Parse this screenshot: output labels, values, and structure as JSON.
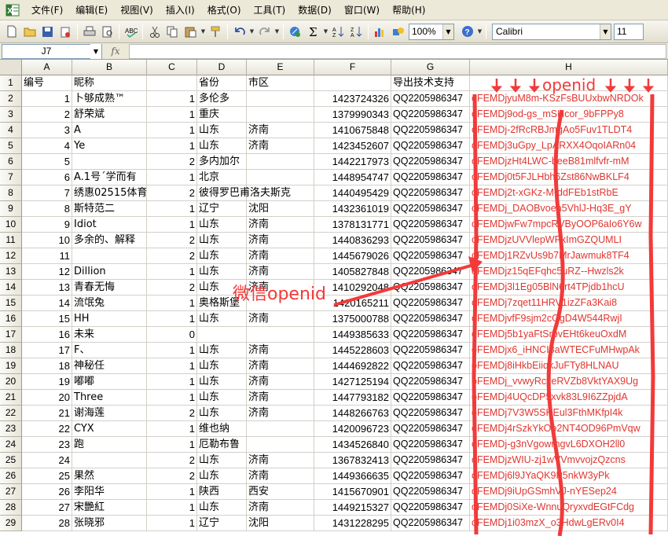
{
  "menu": {
    "items": [
      "文件(F)",
      "编辑(E)",
      "视图(V)",
      "插入(I)",
      "格式(O)",
      "工具(T)",
      "数据(D)",
      "窗口(W)",
      "帮助(H)"
    ]
  },
  "toolbar": {
    "zoom": "100%",
    "font_name": "Calibri",
    "font_size": "11",
    "icons": [
      "new-icon",
      "open-icon",
      "save-icon",
      "permission-icon",
      "print-icon",
      "print-preview-icon",
      "spelling-icon",
      "cut-icon",
      "copy-icon",
      "paste-icon",
      "format-painter-icon",
      "undo-icon",
      "redo-icon",
      "hyperlink-icon",
      "autosum-icon",
      "sort-asc-icon",
      "sort-desc-icon",
      "chart-wizard-icon",
      "drawing-icon",
      "help-icon"
    ]
  },
  "formula_bar": {
    "name_box": "J7",
    "fx_label": "fx",
    "value": ""
  },
  "sheet": {
    "columns": [
      "A",
      "B",
      "C",
      "D",
      "E",
      "F",
      "G",
      "H"
    ],
    "headers": {
      "a": "编号",
      "b": "昵称",
      "c": "",
      "d": "省份",
      "e": "市区",
      "f": "",
      "g": "导出技术支持",
      "h": ""
    },
    "rows": [
      {
        "n": 2,
        "a": "1",
        "b": "卜够成熟™",
        "c": "1",
        "d": "多伦多",
        "e": "",
        "f": "1423724326",
        "g": "QQ2205986347",
        "h": "oFEMDjyuM8m-KSzFsBUUxbwNRDOk"
      },
      {
        "n": 3,
        "a": "2",
        "b": "舒荣斌",
        "c": "1",
        "d": "重庆",
        "e": "",
        "f": "1379990343",
        "g": "QQ2205986347",
        "h": "oFEMDj9od-gs_mSHcor_9bFPPy8"
      },
      {
        "n": 4,
        "a": "3",
        "b": "A",
        "c": "1",
        "d": "山东",
        "e": "济南",
        "f": "1410675848",
        "g": "QQ2205986347",
        "h": "oFEMDj-2fRcRBJmgAo5Fuv1TLDT4"
      },
      {
        "n": 5,
        "a": "4",
        "b": "Ye",
        "c": "1",
        "d": "山东",
        "e": "济南",
        "f": "1423452607",
        "g": "QQ2205986347",
        "h": "oFEMDj3uGpy_LpARXX4OqoIARn04"
      },
      {
        "n": 6,
        "a": "5",
        "b": "",
        "c": "2",
        "d": "多内加尔",
        "e": "",
        "f": "1442217973",
        "g": "QQ2205986347",
        "h": "oFEMDjzHt4LWC-beeB81mlfvfr-mM"
      },
      {
        "n": 7,
        "a": "6",
        "b": "A.1号ˊ学而有",
        "c": "1",
        "d": "北京",
        "e": "",
        "f": "1448954747",
        "g": "QQ2205986347",
        "h": "oFEMDj0t5FJLHbh6Zst86NwBKLF4"
      },
      {
        "n": 8,
        "a": "7",
        "b": "绣惠02515体育",
        "c": "2",
        "d": "彼得罗巴甫洛夫斯克",
        "e": "",
        "f": "1440495429",
        "g": "QQ2205986347",
        "h": "oFEMDj2t-xGKz-M-ddFEb1stRbE"
      },
      {
        "n": 9,
        "a": "8",
        "b": "斯特范二",
        "c": "1",
        "d": "辽宁",
        "e": "沈阳",
        "f": "1432361019",
        "g": "QQ2205986347",
        "h": "oFEMDj_DAOBvoen5VhlJ-Hq3E_gY"
      },
      {
        "n": 10,
        "a": "9",
        "b": "Idiot",
        "c": "1",
        "d": "山东",
        "e": "济南",
        "f": "1378131771",
        "g": "QQ2205986347",
        "h": "oFEMDjwFw7mpcRVByOOP6aIo6Y6w"
      },
      {
        "n": 11,
        "a": "10",
        "b": "多余的、解释",
        "c": "2",
        "d": "山东",
        "e": "济南",
        "f": "1440836293",
        "g": "QQ2205986347",
        "h": "oFEMDjzUVVlepWPkImGZQUMLI"
      },
      {
        "n": 12,
        "a": "11",
        "b": "",
        "c": "2",
        "d": "山东",
        "e": "济南",
        "f": "1445679026",
        "g": "QQ2205986347",
        "h": "oFEMDj1RZvUs9b7MrJawmuk8TF4"
      },
      {
        "n": 13,
        "a": "12",
        "b": "Dillion",
        "c": "1",
        "d": "山东",
        "e": "济南",
        "f": "1405827848",
        "g": "QQ2205986347",
        "h": "oFEMDjz15qEFqhc5uRZ--Hwzls2k"
      },
      {
        "n": 14,
        "a": "13",
        "b": "青春无悔",
        "c": "2",
        "d": "山东",
        "e": "济南",
        "f": "1410292048",
        "g": "QQ2205986347",
        "h": "oFEMDj3l1Eg05BlN6rt4TPjdb1hcU"
      },
      {
        "n": 15,
        "a": "14",
        "b": "流氓兔",
        "c": "1",
        "d": "奥格斯堡",
        "e": "",
        "f": "1420165211",
        "g": "QQ2205986347",
        "h": "oFEMDj7zqet11HRV1izZFa3Kai8"
      },
      {
        "n": 16,
        "a": "15",
        "b": "HH",
        "c": "1",
        "d": "山东",
        "e": "济南",
        "f": "1375000788",
        "g": "QQ2205986347",
        "h": "oFEMDjvfF9sjm2cGgD4W544RwjI"
      },
      {
        "n": 17,
        "a": "16",
        "b": "未来",
        "c": "0",
        "d": "",
        "e": "",
        "f": "1449385633",
        "g": "QQ2205986347",
        "h": "oFEMDj5b1yaFtSrbvEHt6keuOxdM"
      },
      {
        "n": 18,
        "a": "17",
        "b": "F、",
        "c": "1",
        "d": "山东",
        "e": "济南",
        "f": "1445228603",
        "g": "QQ2205986347",
        "h": "oFEMDjx6_iHNCI8aWTECFuMHwpAk"
      },
      {
        "n": 19,
        "a": "18",
        "b": "神秘任",
        "c": "1",
        "d": "山东",
        "e": "济南",
        "f": "1444692822",
        "g": "QQ2205986347",
        "h": "oFEMDj8iHkbEiiqkJuFTy8HLNAU"
      },
      {
        "n": 20,
        "a": "19",
        "b": "嘟嘟",
        "c": "1",
        "d": "山东",
        "e": "济南",
        "f": "1427125194",
        "g": "QQ2205986347",
        "h": "oFEMDj_vvwyRcxeRVZb8VktYAX9Ug"
      },
      {
        "n": 21,
        "a": "20",
        "b": "Three",
        "c": "1",
        "d": "山东",
        "e": "济南",
        "f": "1447793182",
        "g": "QQ2205986347",
        "h": "oFEMDj4UQcDP5xvk83L9I6ZZpjdA"
      },
      {
        "n": 22,
        "a": "21",
        "b": "谢海莲",
        "c": "2",
        "d": "山东",
        "e": "济南",
        "f": "1448266763",
        "g": "QQ2205986347",
        "h": "oFEMDj7V3W5SHEul3FthMKfpI4k"
      },
      {
        "n": 23,
        "a": "22",
        "b": "CYX",
        "c": "1",
        "d": "维也纳",
        "e": "",
        "f": "1420096723",
        "g": "QQ2205986347",
        "h": "oFEMDj4rSzkYkOp2NT4OD96PmVqw"
      },
      {
        "n": 24,
        "a": "23",
        "b": "跑",
        "c": "1",
        "d": "厄勒布鲁",
        "e": "",
        "f": "1434526840",
        "g": "QQ2205986347",
        "h": "oFEMDj-g3nVgowrngvL6DXOH2ll0"
      },
      {
        "n": 25,
        "a": "24",
        "b": "",
        "c": "2",
        "d": "山东",
        "e": "济南",
        "f": "1367832413",
        "g": "QQ2205986347",
        "h": "oFEMDjzWIU-zj1wVVmvvojzQzcns"
      },
      {
        "n": 26,
        "a": "25",
        "b": "果然",
        "c": "2",
        "d": "山东",
        "e": "济南",
        "f": "1449366635",
        "g": "QQ2205986347",
        "h": "oFEMDj6l9JYaQK9P5nkW3yPk"
      },
      {
        "n": 27,
        "a": "26",
        "b": "李阳华",
        "c": "1",
        "d": "陕西",
        "e": "西安",
        "f": "1415670901",
        "g": "QQ2205986347",
        "h": "oFEMDj9iUpGSmhVJ-nYESep24"
      },
      {
        "n": 28,
        "a": "27",
        "b": "宋艷紅",
        "c": "1",
        "d": "山东",
        "e": "济南",
        "f": "1449215327",
        "g": "QQ2205986347",
        "h": "oFEMDj0SiXe-WnnuQryxvdEGtFCdg"
      },
      {
        "n": 29,
        "a": "28",
        "b": "张晓邪",
        "c": "1",
        "d": "辽宁",
        "e": "沈阳",
        "f": "1431228295",
        "g": "QQ2205986347",
        "h": "oFEMDj1i03mzX_o3HdwLgERv0I4"
      }
    ]
  },
  "annotations": {
    "header_label": "openid",
    "weixin_label": "微信openid",
    "color": "#f23a3a"
  }
}
